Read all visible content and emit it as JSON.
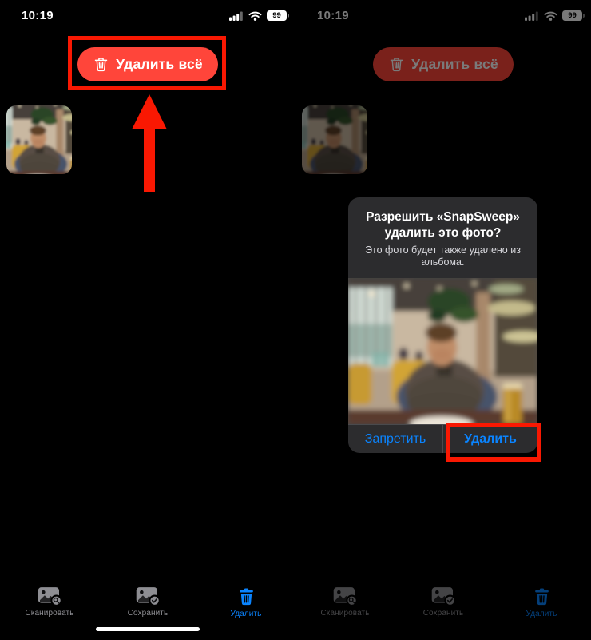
{
  "status_bar": {
    "time": "10:19",
    "battery": "99"
  },
  "buttons": {
    "delete_all": "Удалить всё"
  },
  "dialog": {
    "title": "Разрешить «SnapSweep» удалить это фото?",
    "message": "Это фото будет также удалено из альбома.",
    "deny": "Запретить",
    "confirm": "Удалить"
  },
  "tabs": [
    {
      "label": "Сканировать",
      "active": false
    },
    {
      "label": "Сохранить",
      "active": false
    },
    {
      "label": "Удалить",
      "active": true
    }
  ],
  "colors": {
    "annotation": "#F91802",
    "ios_red": "#FF453A",
    "ios_blue": "#0A84FF",
    "tab_inactive": "#8E8E93",
    "dialog_bg": "#2C2C2E"
  }
}
